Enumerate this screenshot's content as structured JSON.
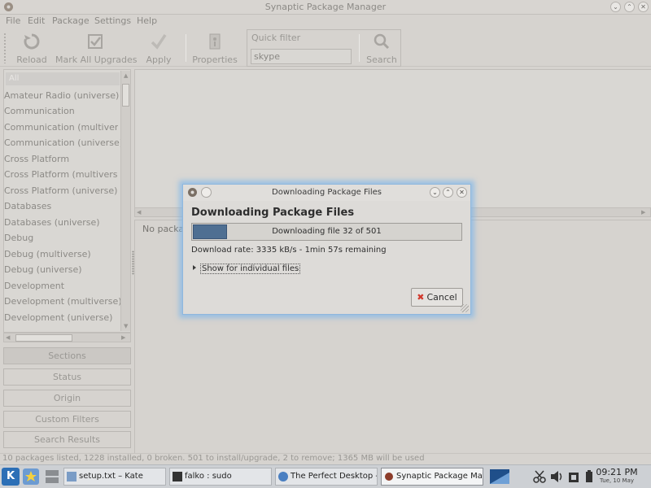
{
  "window": {
    "title": "Synaptic Package Manager",
    "controls": [
      "⌄",
      "⌃",
      "✕"
    ]
  },
  "menubar": [
    "File",
    "Edit",
    "Package",
    "Settings",
    "Help"
  ],
  "toolbar": {
    "reload": "Reload",
    "mark_all_upgrades": "Mark All Upgrades",
    "apply": "Apply",
    "properties": "Properties",
    "search": "Search",
    "quick_filter_label": "Quick filter",
    "quick_filter_value": "skype"
  },
  "sections_list": {
    "selected": "All",
    "items": [
      "Amateur Radio (universe)",
      "Communication",
      "Communication (multiverse)",
      "Communication (universe)",
      "Cross Platform",
      "Cross Platform (multiverse)",
      "Cross Platform (universe)",
      "Databases",
      "Databases (universe)",
      "Debug",
      "Debug (multiverse)",
      "Debug (universe)",
      "Development",
      "Development (multiverse)",
      "Development (universe)"
    ]
  },
  "filter_buttons": [
    "Sections",
    "Status",
    "Origin",
    "Custom Filters",
    "Search Results"
  ],
  "description_pane": {
    "text": "No packa"
  },
  "statusbar": {
    "text": "10 packages listed, 1228 installed, 0 broken. 501 to install/upgrade, 2 to remove; 1365 MB will be used"
  },
  "dialog": {
    "title": "Downloading Package Files",
    "heading": "Downloading Package Files",
    "progress_text": "Downloading file 32 of 501",
    "progress_fraction": 0.064,
    "rate_text": "Download rate: 3335 kB/s - 1min 57s remaining",
    "expander_label": "Show for individual files",
    "cancel_label": "Cancel",
    "controls": [
      "⌄",
      "⌃",
      "✕"
    ]
  },
  "taskbar": {
    "k_label": "K",
    "tasks": [
      {
        "label": "setup.txt – Kate"
      },
      {
        "label": "falko : sudo"
      },
      {
        "label": "The Perfect Desktop - "
      },
      {
        "label": "Synaptic Package Mana"
      }
    ],
    "clock_time": "09:21 PM",
    "clock_date": "Tue, 10 May"
  },
  "colors": {
    "progress_fill": "#4f6f92",
    "dialog_glow": "#78b4eb",
    "cancel_icon": "#d23a2e",
    "kmenu": "#2c6fb6"
  }
}
